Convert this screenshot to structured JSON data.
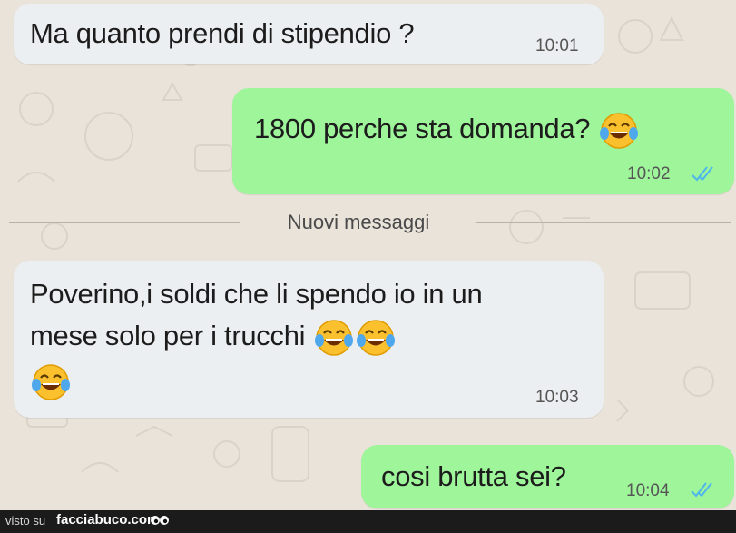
{
  "messages": [
    {
      "direction": "incoming",
      "text": "Ma quanto prendi di stipendio ?",
      "time": "10:01"
    },
    {
      "direction": "outgoing",
      "text": "1800 perche sta domanda?",
      "emoji": "face-with-tears-of-joy",
      "time": "10:02",
      "status": "read"
    },
    {
      "direction": "incoming",
      "text_line1": "Poverino,i soldi che li spendo io in un",
      "text_line2": "mese solo per i trucchi",
      "emoji": "face-with-tears-of-joy",
      "time": "10:03"
    },
    {
      "direction": "outgoing",
      "text": "cosi brutta sei?",
      "time": "10:04",
      "status": "read"
    }
  ],
  "divider": {
    "label": "Nuovi messaggi"
  },
  "footer": {
    "visto_su": "visto su",
    "brand": "facciabuco.com"
  },
  "colors": {
    "incoming_bubble": "#eceff1",
    "outgoing_bubble": "#9ef59a",
    "read_ticks": "#4fb6ec",
    "wallpaper": "#e9e3da"
  }
}
